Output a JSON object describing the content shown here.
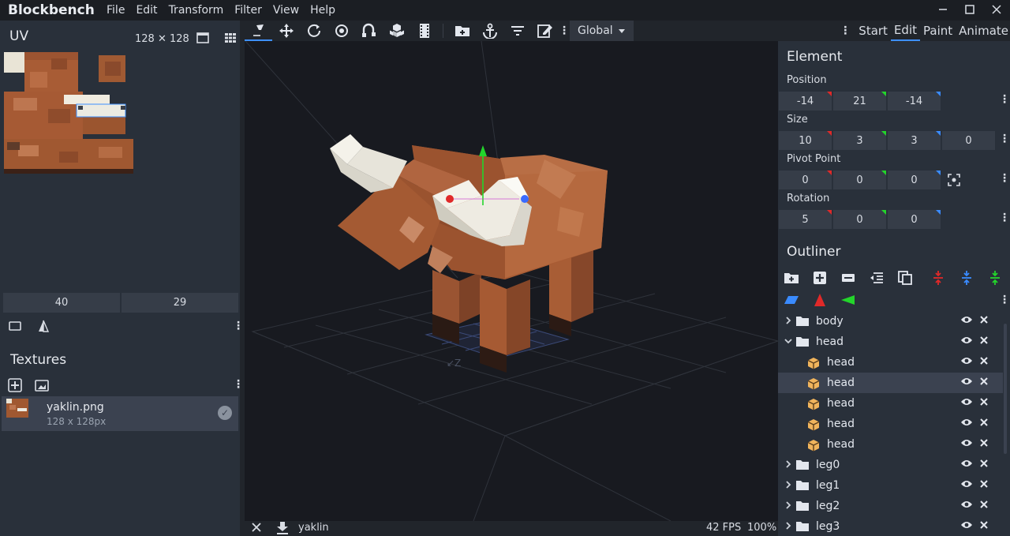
{
  "app": {
    "name": "Blockbench",
    "menu": [
      "File",
      "Edit",
      "Transform",
      "Filter",
      "View",
      "Help"
    ]
  },
  "toolbar": {
    "space": "Global",
    "modes": [
      "Start",
      "Edit",
      "Paint",
      "Animate"
    ],
    "active_mode": "Edit"
  },
  "uv": {
    "title": "UV",
    "size": "128 ✕ 128",
    "field_u": "40",
    "field_v": "29"
  },
  "textures": {
    "title": "Textures",
    "items": [
      {
        "name": "yaklin.png",
        "meta": "128 x 128px"
      }
    ]
  },
  "element": {
    "title": "Element",
    "position_label": "Position",
    "position": [
      "-14",
      "21",
      "-14"
    ],
    "size_label": "Size",
    "size": [
      "10",
      "3",
      "3",
      "0"
    ],
    "pivot_label": "Pivot Point",
    "pivot": [
      "0",
      "0",
      "0"
    ],
    "rotation_label": "Rotation",
    "rotation": [
      "5",
      "0",
      "0"
    ]
  },
  "outliner": {
    "title": "Outliner",
    "rows": [
      {
        "name": "body",
        "type": "group",
        "expanded": false,
        "depth": 0
      },
      {
        "name": "head",
        "type": "group",
        "expanded": true,
        "depth": 0
      },
      {
        "name": "head",
        "type": "cube",
        "depth": 1
      },
      {
        "name": "head",
        "type": "cube",
        "depth": 1,
        "selected": true
      },
      {
        "name": "head",
        "type": "cube",
        "depth": 1
      },
      {
        "name": "head",
        "type": "cube",
        "depth": 1
      },
      {
        "name": "head",
        "type": "cube",
        "depth": 1
      },
      {
        "name": "leg0",
        "type": "group",
        "expanded": false,
        "depth": 0
      },
      {
        "name": "leg1",
        "type": "group",
        "expanded": false,
        "depth": 0
      },
      {
        "name": "leg2",
        "type": "group",
        "expanded": false,
        "depth": 0
      },
      {
        "name": "leg3",
        "type": "group",
        "expanded": false,
        "depth": 0
      }
    ]
  },
  "statusbar": {
    "project": "yaklin",
    "fps": "42 FPS",
    "zoom": "100%"
  },
  "colors": {
    "accent": "#3e90ff",
    "axis_x": "#e02929",
    "axis_y": "#23d52b",
    "axis_z": "#3a8bff",
    "fur": "#b1623a",
    "horn": "#f1efe6"
  }
}
